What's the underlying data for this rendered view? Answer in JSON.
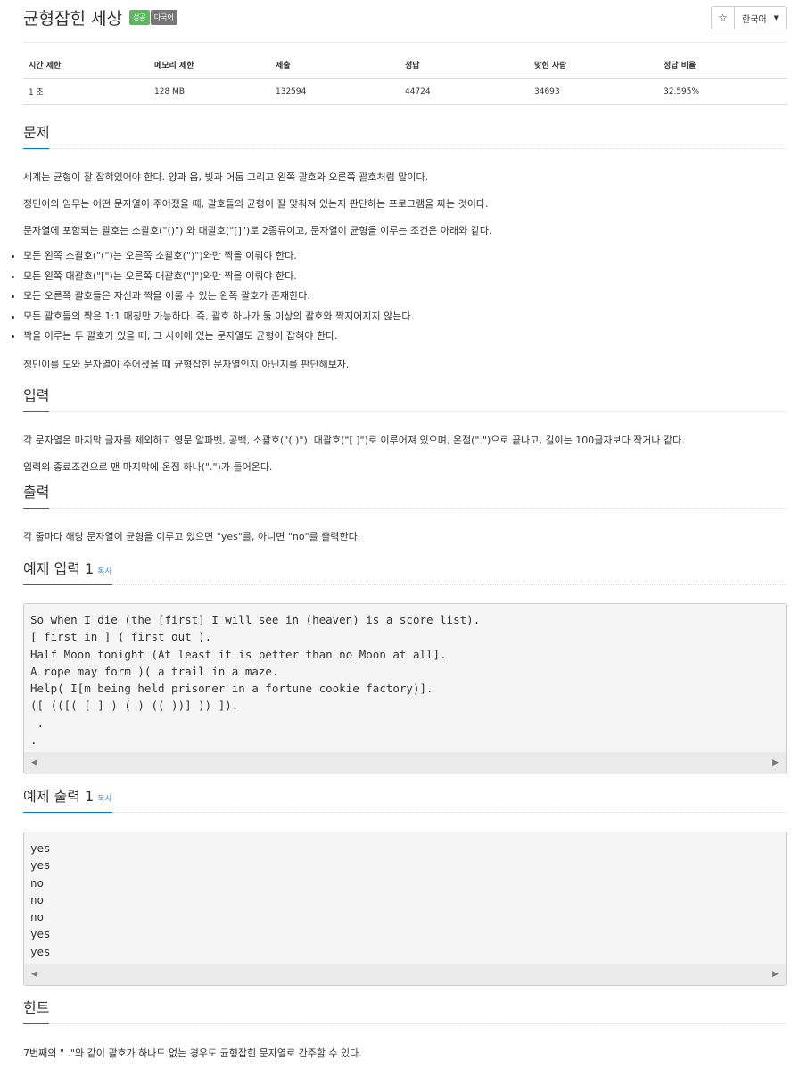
{
  "header": {
    "title": "균형잡힌 세상",
    "badge_success": "성공",
    "badge_lang": "다국어",
    "star_icon": "☆",
    "language": "한국어"
  },
  "info_table": {
    "headers": [
      "시간 제한",
      "메모리 제한",
      "제출",
      "정답",
      "맞힌 사람",
      "정답 비율"
    ],
    "values": [
      "1 초",
      "128 MB",
      "132594",
      "44724",
      "34693",
      "32.595%"
    ]
  },
  "problem": {
    "title": "문제",
    "p1": "세계는 균형이 잘 잡혀있어야 한다. 양과 음, 빛과 어둠 그리고 왼쪽 괄호와 오른쪽 괄호처럼 말이다.",
    "p2": "정민이의 임무는 어떤 문자열이 주어졌을 때, 괄호들의 균형이 잘 맞춰져 있는지 판단하는 프로그램을 짜는 것이다.",
    "p3": "문자열에 포함되는 괄호는 소괄호(\"()\") 와 대괄호(\"[]\")로 2종류이고, 문자열이 균형을 이루는 조건은 아래와 같다.",
    "rules": [
      "모든 왼쪽 소괄호(\"(\")는 오른쪽 소괄호(\")\")와만 짝을 이뤄야 한다.",
      "모든 왼쪽 대괄호(\"[\")는 오른쪽 대괄호(\"]\")와만 짝을 이뤄야 한다.",
      "모든 오른쪽 괄호들은 자신과 짝을 이룰 수 있는 왼쪽 괄호가 존재한다.",
      "모든 괄호들의 짝은 1:1 매칭만 가능하다. 즉, 괄호 하나가 둘 이상의 괄호와 짝지어지지 않는다.",
      "짝을 이루는 두 괄호가 있을 때, 그 사이에 있는 문자열도 균형이 잡혀야 한다."
    ],
    "p4": "정민이를 도와 문자열이 주어졌을 때 균형잡힌 문자열인지 아닌지를 판단해보자."
  },
  "input": {
    "title": "입력",
    "p1": "각 문자열은 마지막 글자를 제외하고 영문 알파벳, 공백, 소괄호(\"( )\"), 대괄호(\"[ ]\")로 이루어져 있으며, 온점(\".\")으로 끝나고, 길이는 100글자보다 작거나 같다.",
    "p2": "입력의 종료조건으로 맨 마지막에 온점 하나(\".\")가 들어온다."
  },
  "output": {
    "title": "출력",
    "p1": "각 줄마다 해당 문자열이 균형을 이루고 있으면 \"yes\"를, 아니면 \"no\"를 출력한다."
  },
  "sample_input": {
    "title": "예제 입력 1",
    "copy": "복사",
    "code": "So when I die (the [first] I will see in (heaven) is a score list).\n[ first in ] ( first out ).\nHalf Moon tonight (At least it is better than no Moon at all].\nA rope may form )( a trail in a maze.\nHelp( I[m being held prisoner in a fortune cookie factory)].\n([ (([( [ ] ) ( ) (( ))] )) ]).\n .\n."
  },
  "sample_output": {
    "title": "예제 출력 1",
    "copy": "복사",
    "code": "yes\nyes\nno\nno\nno\nyes\nyes"
  },
  "hint": {
    "title": "힌트",
    "p1": "7번째의 \" .\"와 같이 괄호가 하나도 없는 경우도 균형잡힌 문자열로 간주할 수 있다."
  },
  "scroll": {
    "left_arrow": "◀",
    "right_arrow": "▶"
  }
}
